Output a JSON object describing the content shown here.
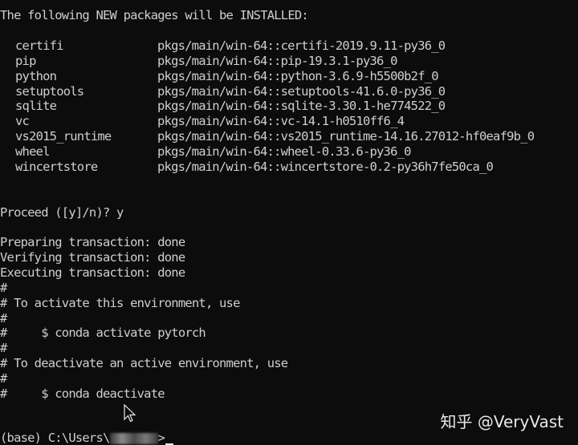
{
  "header": "The following NEW packages will be INSTALLED:",
  "packages": [
    {
      "name": "certifi",
      "source": "pkgs/main/win-64::certifi-2019.9.11-py36_0"
    },
    {
      "name": "pip",
      "source": "pkgs/main/win-64::pip-19.3.1-py36_0"
    },
    {
      "name": "python",
      "source": "pkgs/main/win-64::python-3.6.9-h5500b2f_0"
    },
    {
      "name": "setuptools",
      "source": "pkgs/main/win-64::setuptools-41.6.0-py36_0"
    },
    {
      "name": "sqlite",
      "source": "pkgs/main/win-64::sqlite-3.30.1-he774522_0"
    },
    {
      "name": "vc",
      "source": "pkgs/main/win-64::vc-14.1-h0510ff6_4"
    },
    {
      "name": "vs2015_runtime",
      "source": "pkgs/main/win-64::vs2015_runtime-14.16.27012-hf0eaf9b_0"
    },
    {
      "name": "wheel",
      "source": "pkgs/main/win-64::wheel-0.33.6-py36_0"
    },
    {
      "name": "wincertstore",
      "source": "pkgs/main/win-64::wincertstore-0.2-py36h7fe50ca_0"
    }
  ],
  "proceed": "Proceed ([y]/n)? y",
  "transaction": [
    "Preparing transaction: done",
    "Verifying transaction: done",
    "Executing transaction: done"
  ],
  "comments": [
    "#",
    "# To activate this environment, use",
    "#",
    "#     $ conda activate pytorch",
    "#",
    "# To deactivate an active environment, use",
    "#",
    "#     $ conda deactivate"
  ],
  "prompt": {
    "prefix": "(base) C:\\Users\\",
    "suffix": ">"
  },
  "watermark": "知乎 @VeryVast",
  "icons": {
    "cursor": "mouse-pointer-icon",
    "redaction": "blurred-username"
  },
  "colors": {
    "background": "#0c0c0c",
    "text": "#cfcfcf"
  }
}
